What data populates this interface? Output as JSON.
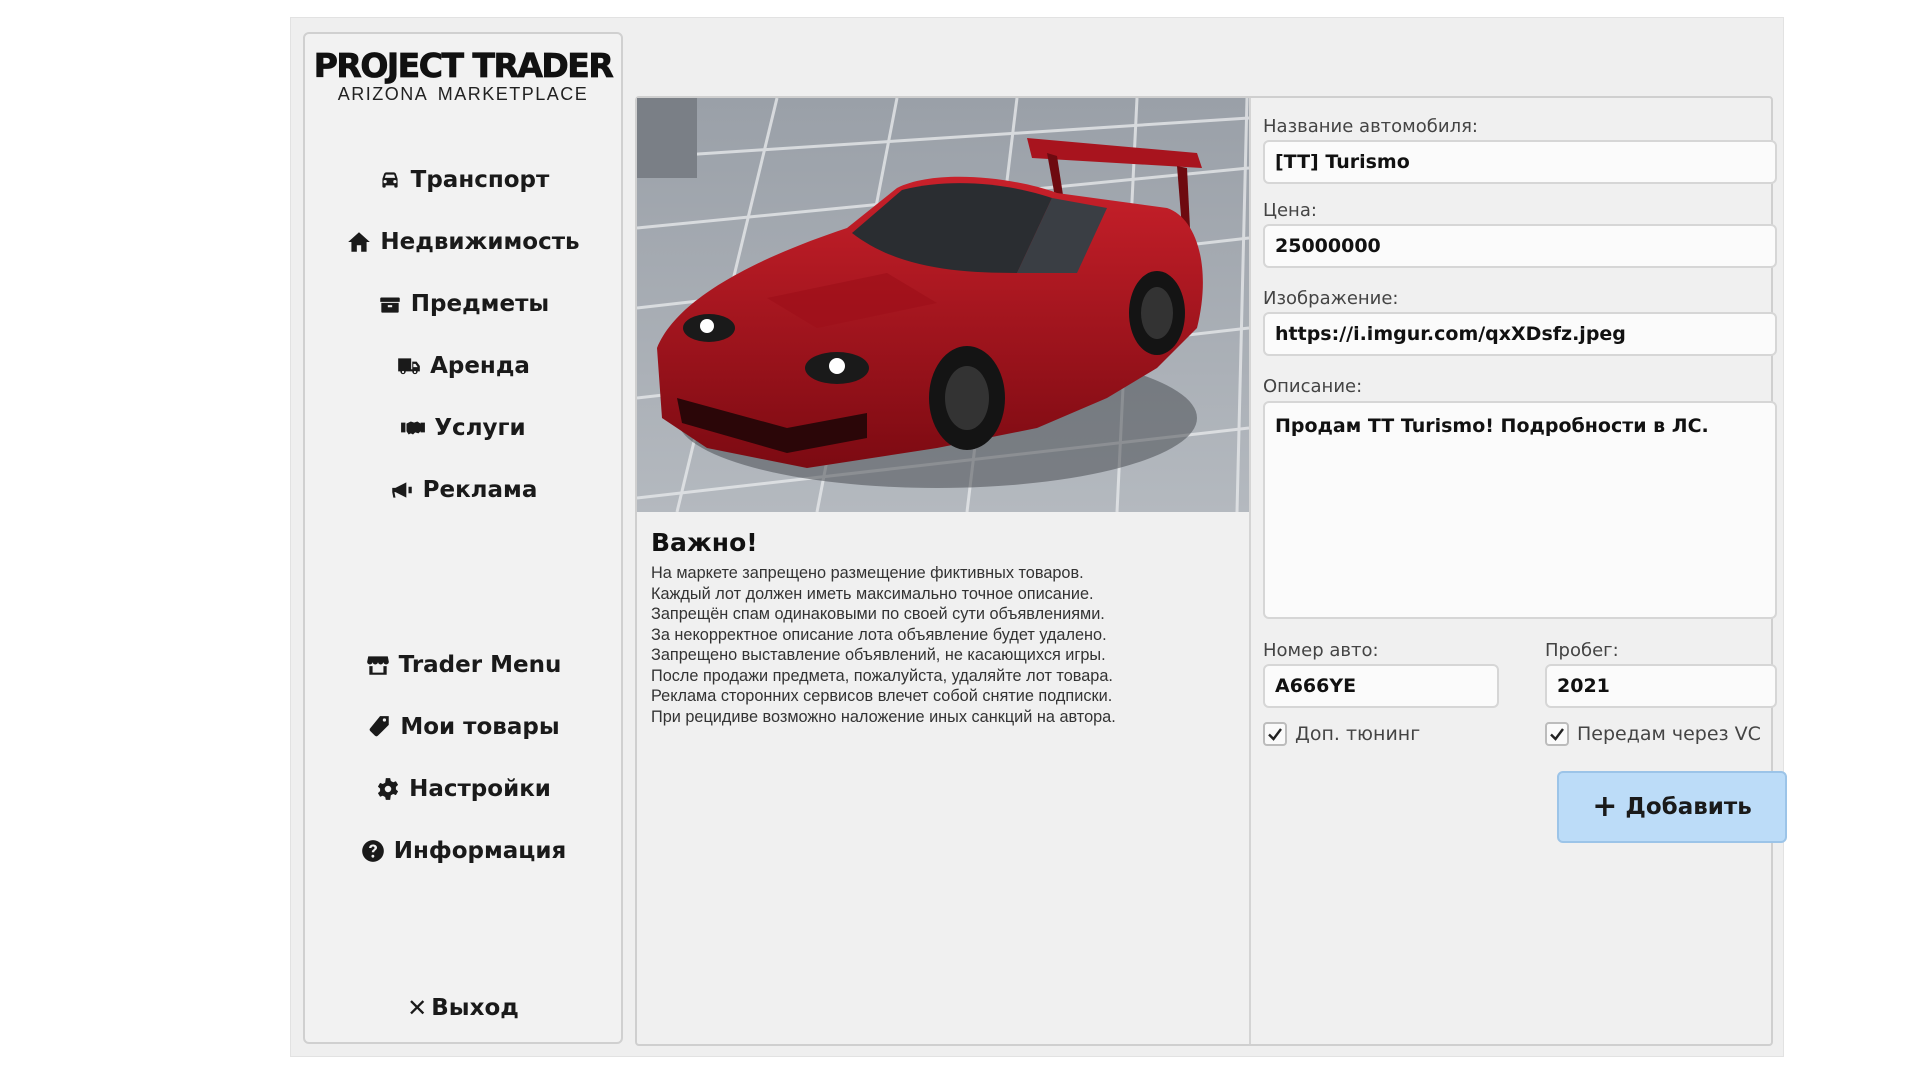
{
  "logo": {
    "title": "PROJECT TRADER",
    "subtitle": "ARIZONA MARKETPLACE"
  },
  "nav_top": [
    {
      "label": "Транспорт",
      "icon": "car-icon"
    },
    {
      "label": "Недвижимость",
      "icon": "home-icon"
    },
    {
      "label": "Предметы",
      "icon": "box-icon"
    },
    {
      "label": "Аренда",
      "icon": "truck-icon"
    },
    {
      "label": "Услуги",
      "icon": "handshake-icon"
    },
    {
      "label": "Реклама",
      "icon": "megaphone-icon"
    }
  ],
  "nav_bottom": [
    {
      "label": "Trader Menu",
      "icon": "store-icon"
    },
    {
      "label": "Мои товары",
      "icon": "tag-icon"
    },
    {
      "label": "Настройки",
      "icon": "gear-icon"
    },
    {
      "label": "Информация",
      "icon": "question-icon"
    }
  ],
  "exit": {
    "label": "Выход",
    "icon": "close-icon"
  },
  "important": {
    "heading": "Важно!",
    "lines": [
      "На маркете запрещено размещение фиктивных товаров.",
      "Каждый лот должен иметь максимально точное описание.",
      "Запрещён спам одинаковыми по своей сути объявлениями.",
      "За некорректное описание лота объявление будет удалено.",
      "Запрещено выставление объявлений, не касающихся игры.",
      "После продажи предмета, пожалуйста, удаляйте лот товара.",
      "Реклама сторонних сервисов влечет собой снятие подписки.",
      "При рецидиве возможно наложение иных санкций на автора."
    ]
  },
  "form": {
    "name_label": "Название автомобиля:",
    "name_value": "[TT] Turismo",
    "price_label": "Цена:",
    "price_value": "25000000",
    "image_label": "Изображение:",
    "image_value": "https://i.imgur.com/qxXDsfz.jpeg",
    "desc_label": "Описание:",
    "desc_value": "Продам TT Turismo! Подробности в ЛС.",
    "plate_label": "Номер авто:",
    "plate_value": "A666YE",
    "mileage_label": "Пробег:",
    "mileage_value": "2021",
    "tuning_label": "Доп. тюнинг",
    "tuning_checked": true,
    "vc_label": "Передам через VC",
    "vc_checked": true,
    "add_label": "Добавить"
  },
  "colors": {
    "car": "#b0121c",
    "button": "#bcdcf8"
  }
}
